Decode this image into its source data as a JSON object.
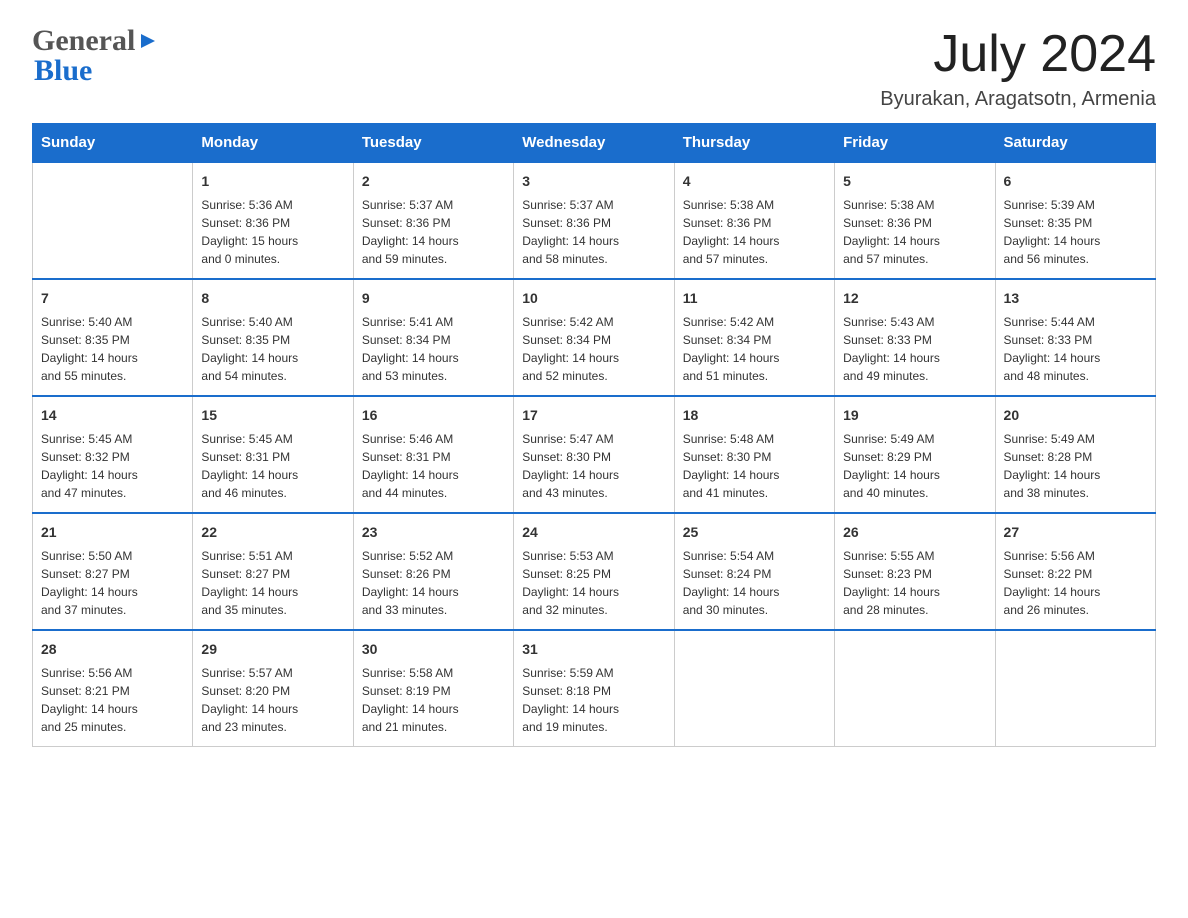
{
  "header": {
    "logo_text1": "General",
    "logo_text2": "Blue",
    "month_year": "July 2024",
    "location": "Byurakan, Aragatsotn, Armenia"
  },
  "days_header": [
    "Sunday",
    "Monday",
    "Tuesday",
    "Wednesday",
    "Thursday",
    "Friday",
    "Saturday"
  ],
  "weeks": [
    [
      {
        "day": "",
        "info": ""
      },
      {
        "day": "1",
        "info": "Sunrise: 5:36 AM\nSunset: 8:36 PM\nDaylight: 15 hours\nand 0 minutes."
      },
      {
        "day": "2",
        "info": "Sunrise: 5:37 AM\nSunset: 8:36 PM\nDaylight: 14 hours\nand 59 minutes."
      },
      {
        "day": "3",
        "info": "Sunrise: 5:37 AM\nSunset: 8:36 PM\nDaylight: 14 hours\nand 58 minutes."
      },
      {
        "day": "4",
        "info": "Sunrise: 5:38 AM\nSunset: 8:36 PM\nDaylight: 14 hours\nand 57 minutes."
      },
      {
        "day": "5",
        "info": "Sunrise: 5:38 AM\nSunset: 8:36 PM\nDaylight: 14 hours\nand 57 minutes."
      },
      {
        "day": "6",
        "info": "Sunrise: 5:39 AM\nSunset: 8:35 PM\nDaylight: 14 hours\nand 56 minutes."
      }
    ],
    [
      {
        "day": "7",
        "info": "Sunrise: 5:40 AM\nSunset: 8:35 PM\nDaylight: 14 hours\nand 55 minutes."
      },
      {
        "day": "8",
        "info": "Sunrise: 5:40 AM\nSunset: 8:35 PM\nDaylight: 14 hours\nand 54 minutes."
      },
      {
        "day": "9",
        "info": "Sunrise: 5:41 AM\nSunset: 8:34 PM\nDaylight: 14 hours\nand 53 minutes."
      },
      {
        "day": "10",
        "info": "Sunrise: 5:42 AM\nSunset: 8:34 PM\nDaylight: 14 hours\nand 52 minutes."
      },
      {
        "day": "11",
        "info": "Sunrise: 5:42 AM\nSunset: 8:34 PM\nDaylight: 14 hours\nand 51 minutes."
      },
      {
        "day": "12",
        "info": "Sunrise: 5:43 AM\nSunset: 8:33 PM\nDaylight: 14 hours\nand 49 minutes."
      },
      {
        "day": "13",
        "info": "Sunrise: 5:44 AM\nSunset: 8:33 PM\nDaylight: 14 hours\nand 48 minutes."
      }
    ],
    [
      {
        "day": "14",
        "info": "Sunrise: 5:45 AM\nSunset: 8:32 PM\nDaylight: 14 hours\nand 47 minutes."
      },
      {
        "day": "15",
        "info": "Sunrise: 5:45 AM\nSunset: 8:31 PM\nDaylight: 14 hours\nand 46 minutes."
      },
      {
        "day": "16",
        "info": "Sunrise: 5:46 AM\nSunset: 8:31 PM\nDaylight: 14 hours\nand 44 minutes."
      },
      {
        "day": "17",
        "info": "Sunrise: 5:47 AM\nSunset: 8:30 PM\nDaylight: 14 hours\nand 43 minutes."
      },
      {
        "day": "18",
        "info": "Sunrise: 5:48 AM\nSunset: 8:30 PM\nDaylight: 14 hours\nand 41 minutes."
      },
      {
        "day": "19",
        "info": "Sunrise: 5:49 AM\nSunset: 8:29 PM\nDaylight: 14 hours\nand 40 minutes."
      },
      {
        "day": "20",
        "info": "Sunrise: 5:49 AM\nSunset: 8:28 PM\nDaylight: 14 hours\nand 38 minutes."
      }
    ],
    [
      {
        "day": "21",
        "info": "Sunrise: 5:50 AM\nSunset: 8:27 PM\nDaylight: 14 hours\nand 37 minutes."
      },
      {
        "day": "22",
        "info": "Sunrise: 5:51 AM\nSunset: 8:27 PM\nDaylight: 14 hours\nand 35 minutes."
      },
      {
        "day": "23",
        "info": "Sunrise: 5:52 AM\nSunset: 8:26 PM\nDaylight: 14 hours\nand 33 minutes."
      },
      {
        "day": "24",
        "info": "Sunrise: 5:53 AM\nSunset: 8:25 PM\nDaylight: 14 hours\nand 32 minutes."
      },
      {
        "day": "25",
        "info": "Sunrise: 5:54 AM\nSunset: 8:24 PM\nDaylight: 14 hours\nand 30 minutes."
      },
      {
        "day": "26",
        "info": "Sunrise: 5:55 AM\nSunset: 8:23 PM\nDaylight: 14 hours\nand 28 minutes."
      },
      {
        "day": "27",
        "info": "Sunrise: 5:56 AM\nSunset: 8:22 PM\nDaylight: 14 hours\nand 26 minutes."
      }
    ],
    [
      {
        "day": "28",
        "info": "Sunrise: 5:56 AM\nSunset: 8:21 PM\nDaylight: 14 hours\nand 25 minutes."
      },
      {
        "day": "29",
        "info": "Sunrise: 5:57 AM\nSunset: 8:20 PM\nDaylight: 14 hours\nand 23 minutes."
      },
      {
        "day": "30",
        "info": "Sunrise: 5:58 AM\nSunset: 8:19 PM\nDaylight: 14 hours\nand 21 minutes."
      },
      {
        "day": "31",
        "info": "Sunrise: 5:59 AM\nSunset: 8:18 PM\nDaylight: 14 hours\nand 19 minutes."
      },
      {
        "day": "",
        "info": ""
      },
      {
        "day": "",
        "info": ""
      },
      {
        "day": "",
        "info": ""
      }
    ]
  ]
}
